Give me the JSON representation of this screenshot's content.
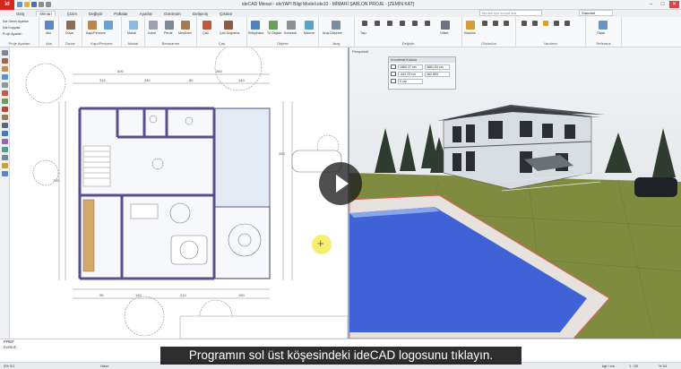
{
  "titlebar": {
    "logo": "id",
    "title": "ideCAD Mimari - ideYAPI Bilgi Modeli.ide10 - MİMARİ ŞABLON PROJE - [ZEMİN KAT]",
    "controls": [
      "–",
      "□",
      "✕"
    ]
  },
  "menu": {
    "tabs": [
      "Giriş",
      "Mimari",
      "Çizim",
      "Değiştir",
      "Paftalar",
      "Ayarlar",
      "Görünüm",
      "Gelişmiş",
      "Çıktılar"
    ],
    "search_placeholder": "Mimari için komut ara",
    "style_value": "Standart"
  },
  "ribbon": {
    "groups": [
      {
        "label": "Proje Ayarları",
        "items": [
          "Kat Genel Ayarları",
          "Kat Kopyala",
          "Proje Ayarları"
        ]
      },
      {
        "label": "Aks",
        "items": [
          "Aks"
        ]
      },
      {
        "label": "Duvar",
        "items": [
          "Duvar"
        ]
      },
      {
        "label": "Kapı/Pencere",
        "items": [
          "Kapı",
          "Kapı/Pencere"
        ]
      },
      {
        "label": "Mahal",
        "items": [
          "Mahal"
        ]
      },
      {
        "label": "Betonarme",
        "items": [
          "Kolon",
          "Perde",
          "Merdiven"
        ]
      },
      {
        "label": "Çatı",
        "items": [
          "Çatı",
          "Çatı Doğrama"
        ]
      },
      {
        "label": "Objeler",
        "items": [
          "Kütüphane",
          "Tıl Objeler",
          "Korkuluk",
          "Manzar"
        ]
      },
      {
        "label": "Araç",
        "items": [
          "Araç Döşeme"
        ]
      },
      {
        "label": "Değiştir",
        "items": [
          "Taşı",
          "Offset"
        ]
      },
      {
        "label": "Görünüm",
        "items": [
          "Klasörle"
        ]
      },
      {
        "label": "Yardımcı",
        "items": [
          "Standart"
        ]
      },
      {
        "label": "Referans",
        "items": [
          "Ölçek"
        ]
      }
    ]
  },
  "views": {
    "perspective_label": "Perspektif",
    "coord_panel": {
      "title": "Koordinat Kutusu",
      "rows": [
        {
          "a": "1865.37 cm",
          "b": "3861.53 cm"
        },
        {
          "a": "-441.23 cm",
          "b": "162.893"
        },
        {
          "a": "0 cm",
          "b": ""
        }
      ]
    }
  },
  "command": {
    "lines": [
      "PREF",
      "Komut:"
    ]
  },
  "status": {
    "left": "0% 0/1",
    "mid": "Hazır",
    "scale": "1 : 50",
    "unit": "kgf / cm",
    "zoom": "% 54"
  },
  "caption": {
    "text": "Programın sol üst köşesindeki ideCAD logosunu tıklayın."
  },
  "colors": {
    "brand": "#d7261e",
    "grass": "#7f8c40",
    "pool": "#3f63d6",
    "wall": "#5b4d8f"
  }
}
